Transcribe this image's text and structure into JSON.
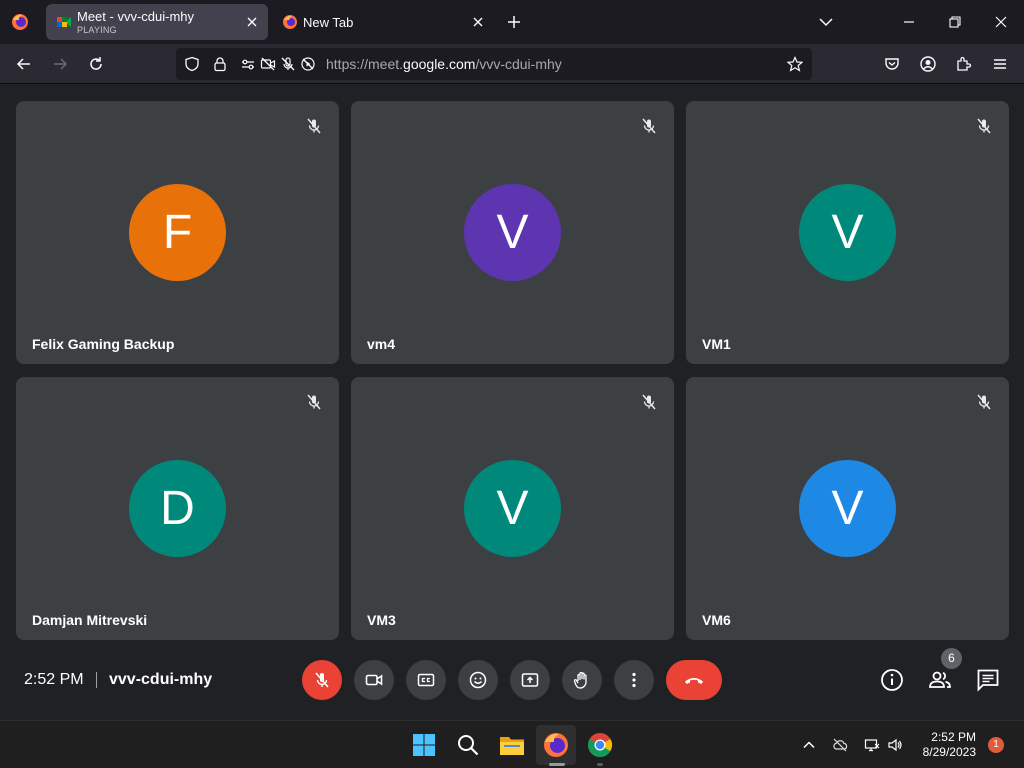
{
  "browser": {
    "tabs": [
      {
        "title": "Meet - vvv-cdui-mhy",
        "subtitle": "PLAYING",
        "active": true
      },
      {
        "title": "New Tab",
        "active": false
      }
    ],
    "url_prefix": "https://meet.",
    "url_host": "google.com",
    "url_path": "/vvv-cdui-mhy"
  },
  "meet": {
    "participants": [
      {
        "name": "Felix Gaming Backup",
        "initial": "F",
        "color": "#e8710a"
      },
      {
        "name": "vm4",
        "initial": "V",
        "color": "#5e35b1"
      },
      {
        "name": "VM1",
        "initial": "V",
        "color": "#00897b"
      },
      {
        "name": "Damjan Mitrevski",
        "initial": "D",
        "color": "#00897b"
      },
      {
        "name": "VM3",
        "initial": "V",
        "color": "#00897b"
      },
      {
        "name": "VM6",
        "initial": "V",
        "color": "#1e88e5"
      }
    ],
    "time": "2:52 PM",
    "meeting_code": "vvv-cdui-mhy",
    "people_count": "6"
  },
  "taskbar": {
    "time": "2:52 PM",
    "date": "8/29/2023",
    "notifications": "1"
  },
  "colors": {
    "danger": "#ea4335",
    "tile": "#3c4043",
    "background": "#202124"
  }
}
